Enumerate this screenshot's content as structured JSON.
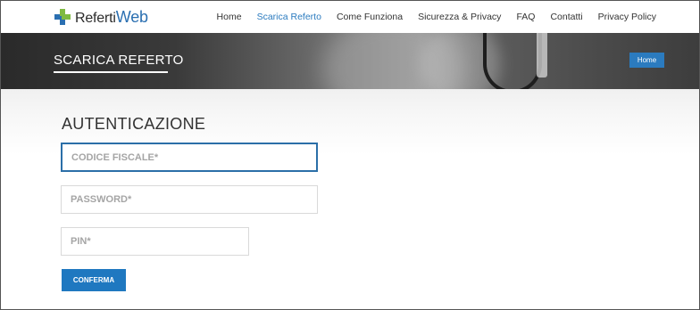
{
  "brand": {
    "name_part1": "Referti",
    "name_part2": "Web"
  },
  "nav": {
    "items": [
      {
        "label": "Home"
      },
      {
        "label": "Scarica Referto"
      },
      {
        "label": "Come Funziona"
      },
      {
        "label": "Sicurezza & Privacy"
      },
      {
        "label": "FAQ"
      },
      {
        "label": "Contatti"
      },
      {
        "label": "Privacy Policy"
      }
    ],
    "active": "Scarica Referto"
  },
  "banner": {
    "title": "SCARICA REFERTO",
    "breadcrumb": "Home"
  },
  "form": {
    "title": "AUTENTICAZIONE",
    "codice_fiscale_placeholder": "CODICE FISCALE*",
    "password_placeholder": "PASSWORD*",
    "pin_placeholder": "PIN*",
    "submit_label": "CONFERMA"
  },
  "colors": {
    "accent": "#2b7bbf",
    "button": "#1f78c0",
    "logo_blue": "#2a6fb1",
    "logo_green": "#7fba42"
  }
}
